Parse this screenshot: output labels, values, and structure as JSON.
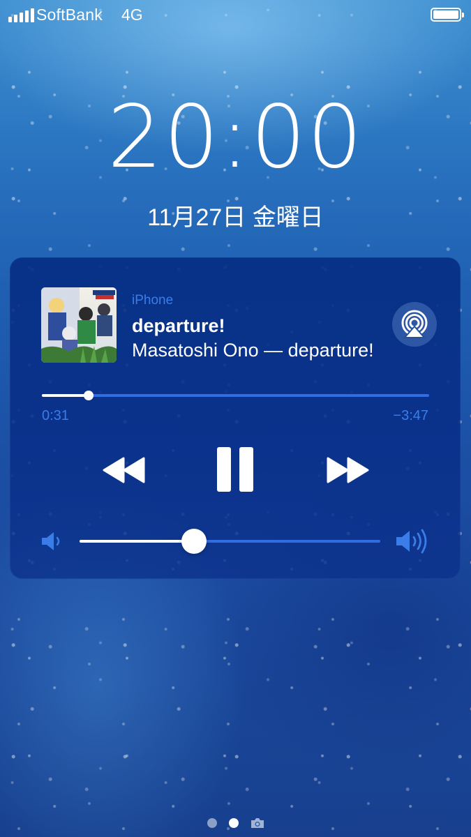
{
  "status_bar": {
    "carrier": "SoftBank",
    "network": "4G",
    "signal_bars": 5,
    "battery_level": 1.0
  },
  "lock_screen": {
    "time": "20:00",
    "date": "11月27日 金曜日"
  },
  "now_playing": {
    "source": "iPhone",
    "title": "departure!",
    "subtitle": "Masatoshi Ono — departure!",
    "elapsed": "0:31",
    "remaining": "−3:47",
    "progress_fraction": 0.12,
    "volume_fraction": 0.38,
    "artwork_icon": "album-art",
    "airplay_icon": "airplay-icon",
    "rewind_icon": "rewind-icon",
    "pause_icon": "pause-icon",
    "forward_icon": "fast-forward-icon",
    "accent_color": "#3a7de8"
  },
  "page_indicator": {
    "pages": 2,
    "active_index": 1,
    "extra_icon": "camera-icon"
  }
}
